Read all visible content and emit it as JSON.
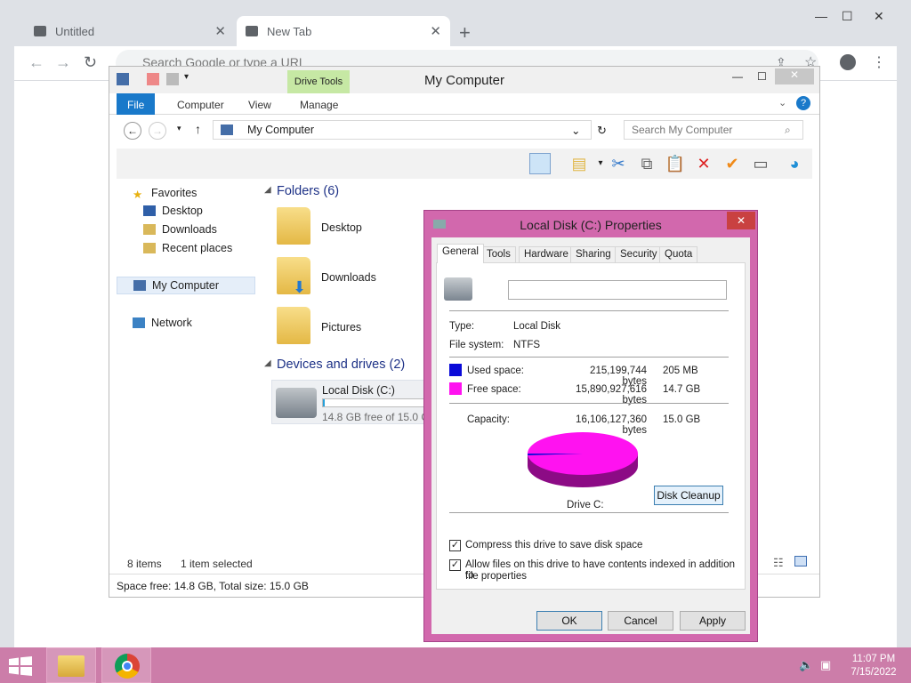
{
  "browser": {
    "tabs": [
      {
        "label": "Untitled"
      },
      {
        "label": "New Tab"
      }
    ],
    "omnibox_placeholder": "Search Google or type a URL"
  },
  "explorer": {
    "title": "My Computer",
    "contextual_tab": "Drive Tools",
    "ribbon_tabs": [
      "File",
      "Computer",
      "View",
      "Manage"
    ],
    "address": "My Computer",
    "search_placeholder": "Search My Computer",
    "nav": {
      "favorites": "Favorites",
      "desktop": "Desktop",
      "downloads": "Downloads",
      "recent": "Recent places",
      "computer": "My Computer",
      "network": "Network"
    },
    "folders_header": "Folders (6)",
    "folders": [
      "Desktop",
      "Downloads",
      "Pictures"
    ],
    "devices_header": "Devices and drives (2)",
    "drive": {
      "name": "Local Disk (C:)",
      "free_text": "14.8 GB free of 15.0 GB",
      "used_fraction": 0.013
    },
    "status": {
      "items": "8 items",
      "selected": "1 item selected"
    },
    "space": "Space free: 14.8 GB, Total size: 15.0 GB"
  },
  "dialog": {
    "title": "Local Disk (C:) Properties",
    "tabs": [
      "General",
      "Tools",
      "Hardware",
      "Sharing",
      "Security",
      "Quota"
    ],
    "name_value": "",
    "type_label": "Type:",
    "type_value": "Local Disk",
    "fs_label": "File system:",
    "fs_value": "NTFS",
    "used_label": "Used space:",
    "used_bytes": "215,199,744 bytes",
    "used_h": "205 MB",
    "free_label": "Free space:",
    "free_bytes": "15,890,927,616 bytes",
    "free_h": "14.7 GB",
    "cap_label": "Capacity:",
    "cap_bytes": "16,106,127,360 bytes",
    "cap_h": "15.0 GB",
    "drive_label": "Drive C:",
    "cleanup": "Disk Cleanup",
    "compress": "Compress this drive to save disk space",
    "index_line1": "Allow files on this drive to have contents indexed in addition to",
    "index_line2": "file properties",
    "ok": "OK",
    "cancel": "Cancel",
    "apply": "Apply",
    "colors": {
      "used": "#0a0ad8",
      "free": "#ff12f0"
    }
  },
  "taskbar": {
    "time": "11:07 PM",
    "date": "7/15/2022"
  }
}
